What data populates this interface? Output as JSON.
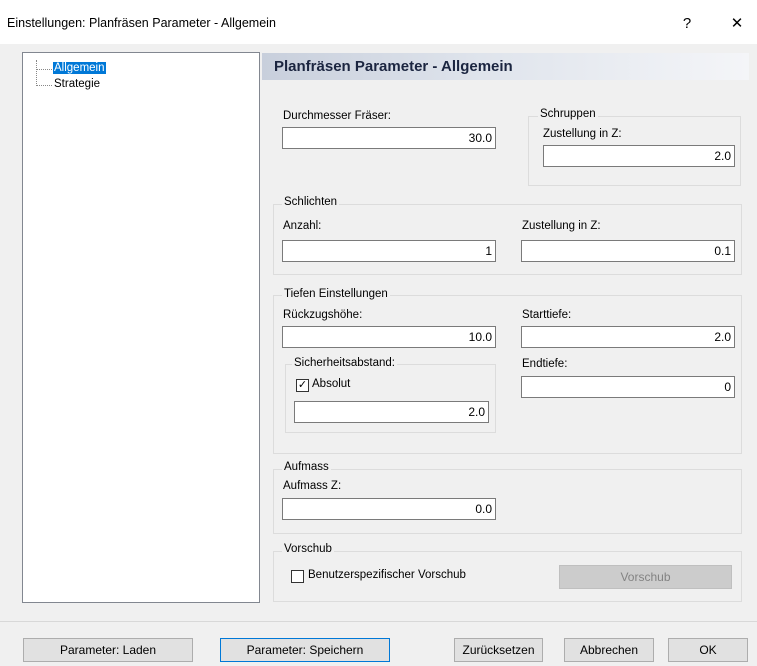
{
  "window": {
    "title": "Einstellungen: Planfräsen Parameter - Allgemein",
    "help_glyph": "?",
    "close_glyph": "✕"
  },
  "tree": {
    "items": [
      {
        "label": "Allgemein",
        "selected": true
      },
      {
        "label": "Strategie",
        "selected": false
      }
    ]
  },
  "panel": {
    "header": "Planfräsen Parameter - Allgemein",
    "durchmesser": {
      "label": "Durchmesser Fräser:",
      "value": "30.0"
    },
    "schruppen": {
      "group": "Schruppen",
      "zustellung_label": "Zustellung in Z:",
      "zustellung_value": "2.0"
    },
    "schlichten": {
      "group": "Schlichten",
      "anzahl_label": "Anzahl:",
      "anzahl_value": "1",
      "zustellung_label": "Zustellung in Z:",
      "zustellung_value": "0.1"
    },
    "tiefen": {
      "group": "Tiefen Einstellungen",
      "rueckzug_label": "Rückzugshöhe:",
      "rueckzug_value": "10.0",
      "starttiefe_label": "Starttiefe:",
      "starttiefe_value": "2.0",
      "sicherheit_group": "Sicherheitsabstand:",
      "absolut_label": "Absolut",
      "absolut_checked": true,
      "sicherheit_value": "2.0",
      "endtiefe_label": "Endtiefe:",
      "endtiefe_value": "0"
    },
    "aufmass": {
      "group": "Aufmass",
      "label": "Aufmass Z:",
      "value": "0.0"
    },
    "vorschub": {
      "group": "Vorschub",
      "checkbox_label": "Benutzerspezifischer Vorschub",
      "checked": false,
      "button": "Vorschub"
    }
  },
  "footer": {
    "laden": "Parameter: Laden",
    "speichern": "Parameter: Speichern",
    "zuruecksetzen": "Zurücksetzen",
    "abbrechen": "Abbrechen",
    "ok": "OK"
  }
}
